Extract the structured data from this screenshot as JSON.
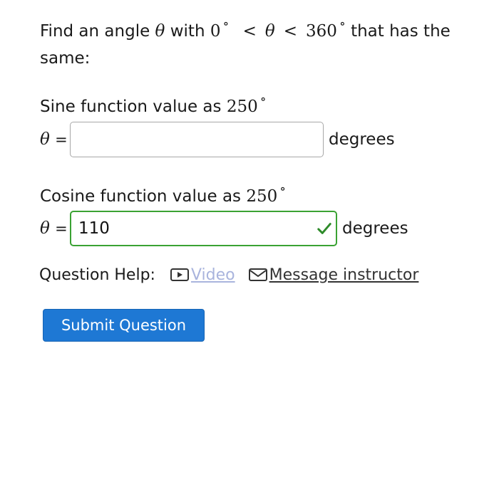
{
  "question": {
    "prompt_prefix": "Find an angle",
    "prompt_theta": "θ",
    "prompt_with": "with",
    "lower_bound": "0",
    "degree_symbol": "∘",
    "less_than": "<",
    "upper_bound": "360",
    "prompt_suffix": "that has the same:"
  },
  "parts": [
    {
      "label_text": "Sine function value as",
      "label_angle": "250",
      "variable": "θ",
      "equals": "=",
      "value": "",
      "unit": "degrees",
      "status": "unanswered"
    },
    {
      "label_text": "Cosine function value as",
      "label_angle": "250",
      "variable": "θ",
      "equals": "=",
      "value": "110",
      "unit": "degrees",
      "status": "correct"
    }
  ],
  "help": {
    "label": "Question Help:",
    "video_label": "Video",
    "video_icon": "video-play-icon",
    "message_label": "Message instructor",
    "message_icon": "mail-icon"
  },
  "submit": {
    "label": "Submit Question"
  },
  "colors": {
    "correct_border": "#3aa233",
    "check_mark": "#2e8b2a",
    "submit_background": "#1e78d4",
    "video_link": "#a9b4dd"
  }
}
